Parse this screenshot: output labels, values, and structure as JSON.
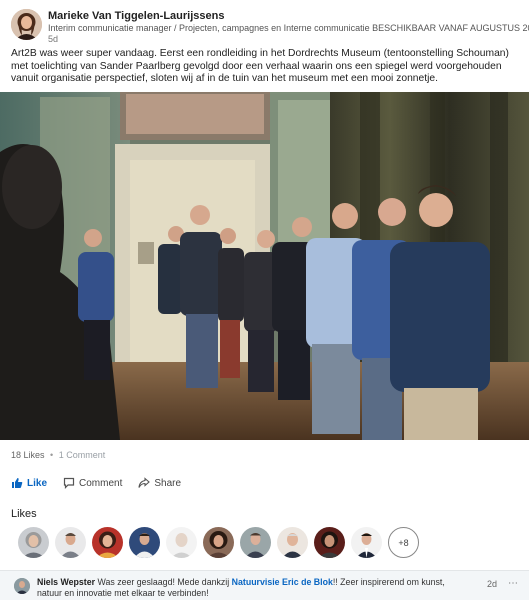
{
  "post": {
    "author_name": "Marieke Van Tiggelen-Laurijssens",
    "author_headline": "Interim communicatie manager / Projecten, campagnes en Interne communicatie BESCHIKBAAR VANAF AUGUSTUS 2017",
    "time": "5d",
    "text": "Art2B was weer super vandaag. Eerst een rondleiding in het Dordrechts Museum (tentoonstelling Schouman)  met toelichting van Sander Paarlberg gevolgd door een verhaal waarin ons een spiegel werd voorgehouden vanuit organisatie perspectief, sloten wij af in de tuin van het museum met een mooi zonnetje."
  },
  "social": {
    "likes_count": "18 Likes",
    "separator": "•",
    "comments_count": "1 Comment"
  },
  "actions": {
    "like": "Like",
    "comment": "Comment",
    "share": "Share"
  },
  "likes_section": {
    "title": "Likes",
    "more": "+8",
    "likers": [
      {
        "icon": "avatar-woman-gray"
      },
      {
        "icon": "avatar-man-gray"
      },
      {
        "icon": "avatar-woman-red"
      },
      {
        "icon": "avatar-man-blue"
      },
      {
        "icon": "avatar-light"
      },
      {
        "icon": "avatar-woman-dark"
      },
      {
        "icon": "avatar-man-light"
      },
      {
        "icon": "avatar-man-older"
      },
      {
        "icon": "avatar-woman-red-dark"
      },
      {
        "icon": "avatar-man-suit"
      }
    ]
  },
  "comment": {
    "author": "Niels Wepster",
    "text_before": "Was zeer geslaagd! Mede dankzij",
    "link": "Natuurvisie Eric de Blok",
    "text_after": "!! Zeer inspirerend om kunst, natuur en innovatie met elkaar te verbinden!",
    "time": "2d",
    "menu": "⋯"
  },
  "colors": {
    "accent": "#0a66c2",
    "text": "#333333",
    "comment_bg": "#f3f6f8"
  }
}
